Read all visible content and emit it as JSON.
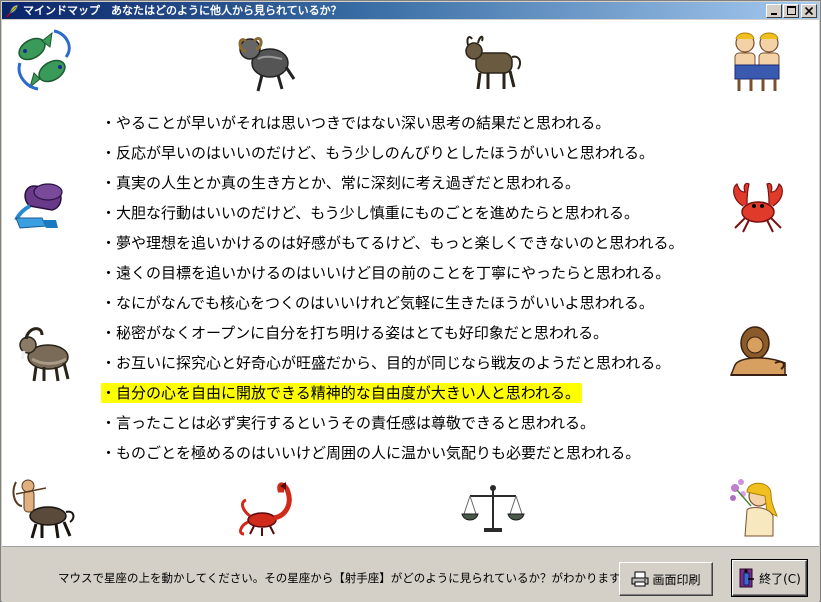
{
  "window": {
    "title": "マインドマップ　あなたはどのように他人から見られているか？",
    "minimize_glyph": "_",
    "maximize_glyph": "□",
    "close_glyph": "×"
  },
  "zodiac_icons": [
    {
      "name": "pisces-icon",
      "label": "魚座"
    },
    {
      "name": "aries-icon",
      "label": "牡羊座"
    },
    {
      "name": "taurus-icon",
      "label": "牡牛座"
    },
    {
      "name": "gemini-icon",
      "label": "双子座"
    },
    {
      "name": "aquarius-icon",
      "label": "水瓶座"
    },
    {
      "name": "cancer-icon",
      "label": "蟹座"
    },
    {
      "name": "capricorn-icon",
      "label": "山羊座"
    },
    {
      "name": "leo-icon",
      "label": "獅子座"
    },
    {
      "name": "sagittarius-icon",
      "label": "射手座"
    },
    {
      "name": "scorpio-icon",
      "label": "蠍座"
    },
    {
      "name": "libra-icon",
      "label": "天秤座"
    },
    {
      "name": "virgo-icon",
      "label": "乙女座"
    }
  ],
  "lines": [
    "・やることが早いがそれは思いつきではない深い思考の結果だと思われる。",
    "・反応が早いのはいいのだけど、もう少しのんびりとしたほうがいいと思われる。",
    "・真実の人生とか真の生き方とか、常に深刻に考え過ぎだと思われる。",
    "・大胆な行動はいいのだけど、もう少し慎重にものごとを進めたらと思われる。",
    "・夢や理想を追いかけるのは好感がもてるけど、もっと楽しくできないのと思われる。",
    "・遠くの目標を追いかけるのはいいけど目の前のことを丁寧にやったらと思われる。",
    "・なにがなんでも核心をつくのはいいけれど気軽に生きたほうがいいよ思われる。",
    "・秘密がなくオープンに自分を打ち明ける姿はとても好印象だと思われる。",
    "・お互いに探究心と好奇心が旺盛だから、目的が同じなら戦友のようだと思われる。",
    "・自分の心を自由に開放できる精神的な自由度が大きい人と思われる。",
    "・言ったことは必ず実行するというその責任感は尊敬できると思われる。",
    "・ものごとを極めるのはいいけど周囲の人に温かい気配りも必要だと思われる。"
  ],
  "highlight_index": 9,
  "highlight_color": "#ffff00",
  "footer": {
    "status": "マウスで星座の上を動かしてください。その星座から【射手座】がどのように見られているか？がわかります。",
    "print_button": "画面印刷",
    "exit_button": "終了(C)"
  },
  "colors": {
    "title_gradient_start": "#0a246a",
    "title_gradient_end": "#a6caf0",
    "face": "#d4d0c8"
  }
}
